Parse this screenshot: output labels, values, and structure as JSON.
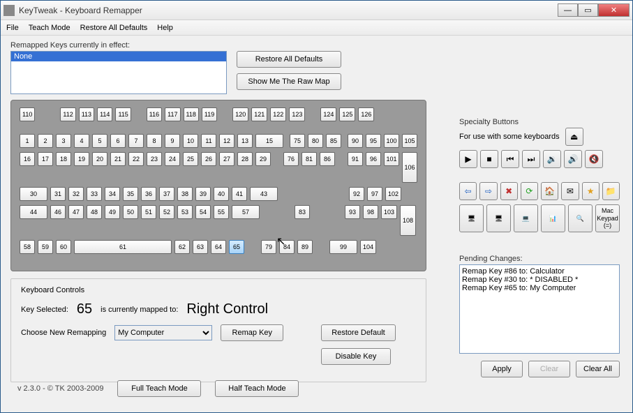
{
  "title": "KeyTweak -   Keyboard Remapper",
  "menu": [
    "File",
    "Teach Mode",
    "Restore All Defaults",
    "Help"
  ],
  "remapped_label": "Remapped Keys currently in effect:",
  "remapped_items": [
    "None"
  ],
  "restore_all_btn": "Restore All Defaults",
  "show_raw_btn": "Show Me The Raw Map",
  "specialty_title": "Specialty Buttons",
  "specialty_sub": "For use with some keyboards",
  "mac_keypad": "Mac Keypad (=)",
  "controls_title": "Keyboard Controls",
  "key_selected_label": "Key Selected:",
  "key_selected_value": "65",
  "mapped_label": "is currently mapped to:",
  "mapped_value": "Right Control",
  "choose_label": "Choose New Remapping",
  "remap_options": [
    "My Computer"
  ],
  "remap_selected": "My Computer",
  "remap_btn": "Remap Key",
  "restore_default_btn": "Restore Default",
  "disable_btn": "Disable Key",
  "pending_title": "Pending Changes:",
  "pending_items": [
    "Remap Key #86 to: Calculator",
    "Remap Key #30 to: * DISABLED *",
    "Remap Key #65 to: My Computer"
  ],
  "apply_btn": "Apply",
  "clear_btn": "Clear",
  "clear_all_btn": "Clear All",
  "version": "v 2.3.0 - © TK 2003-2009",
  "full_teach_btn": "Full Teach Mode",
  "half_teach_btn": "Half Teach Mode",
  "selected_key": "65",
  "keyboard": {
    "row0": [
      [
        "110"
      ],
      [
        "112",
        "113",
        "114",
        "115"
      ],
      [
        "116",
        "117",
        "118",
        "119"
      ],
      [
        "120",
        "121",
        "122",
        "123"
      ],
      [
        "124",
        "125",
        "126"
      ]
    ],
    "row1_main": [
      "1",
      "2",
      "3",
      "4",
      "5",
      "6",
      "7",
      "8",
      "9",
      "10",
      "11",
      "12",
      "13",
      "15"
    ],
    "row1_nav": [
      "75",
      "80",
      "85"
    ],
    "row1_num": [
      "90",
      "95",
      "100",
      "105"
    ],
    "row2_main": [
      "16",
      "17",
      "18",
      "19",
      "20",
      "21",
      "22",
      "23",
      "24",
      "25",
      "26",
      "27",
      "28",
      "29"
    ],
    "row2_nav": [
      "76",
      "81",
      "86"
    ],
    "row2_num": [
      "91",
      "96",
      "101"
    ],
    "row2_num_tall": "106",
    "row3_main": [
      "30",
      "31",
      "32",
      "33",
      "34",
      "35",
      "36",
      "37",
      "38",
      "39",
      "40",
      "41",
      "43"
    ],
    "row3_num": [
      "92",
      "97",
      "102"
    ],
    "row4_main": [
      "44",
      "46",
      "47",
      "48",
      "49",
      "50",
      "51",
      "52",
      "53",
      "54",
      "55",
      "57"
    ],
    "row4_nav": [
      "83"
    ],
    "row4_num": [
      "93",
      "98",
      "103"
    ],
    "row4_num_tall": "108",
    "row5_main": [
      "58",
      "59",
      "60",
      "61",
      "62",
      "63",
      "64",
      "65"
    ],
    "row5_nav": [
      "79",
      "84",
      "89"
    ],
    "row5_num": [
      "99",
      "104"
    ]
  }
}
